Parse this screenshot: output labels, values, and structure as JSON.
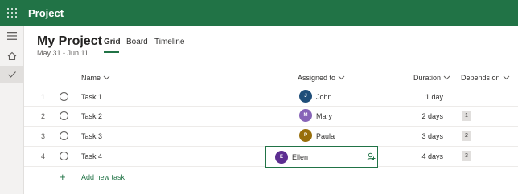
{
  "app": {
    "title": "Project"
  },
  "project": {
    "name": "My Project",
    "dates": "May 31 - Jun 11"
  },
  "tabs": [
    {
      "label": "Grid",
      "active": true
    },
    {
      "label": "Board",
      "active": false
    },
    {
      "label": "Timeline",
      "active": false
    }
  ],
  "columns": {
    "name": "Name",
    "assigned": "Assigned to",
    "duration": "Duration",
    "depends": "Depends on"
  },
  "tasks": [
    {
      "num": "1",
      "name": "Task 1",
      "initial": "J",
      "person": "John",
      "avatar_color": "#1f4e79",
      "duration": "1 day",
      "depends": ""
    },
    {
      "num": "2",
      "name": "Task 2",
      "initial": "M",
      "person": "Mary",
      "avatar_color": "#8764b8",
      "duration": "2 days",
      "depends": "1"
    },
    {
      "num": "3",
      "name": "Task 3",
      "initial": "P",
      "person": "Paula",
      "avatar_color": "#986f0b",
      "duration": "3 days",
      "depends": "2"
    },
    {
      "num": "4",
      "name": "Task 4",
      "initial": "E",
      "person": "Ellen",
      "avatar_color": "#5c2e91",
      "duration": "4 days",
      "depends": "3"
    }
  ],
  "add_task": {
    "label": "Add new task"
  },
  "colors": {
    "brand": "#217346",
    "rail": "#f3f2f1",
    "dep_badge": "#e1dfdd"
  },
  "icons": {
    "app_launcher": "waffle-icon",
    "menu": "hamburger-icon",
    "home": "home-icon",
    "checkmark": "checkmark-icon",
    "assign": "add-person-icon"
  }
}
